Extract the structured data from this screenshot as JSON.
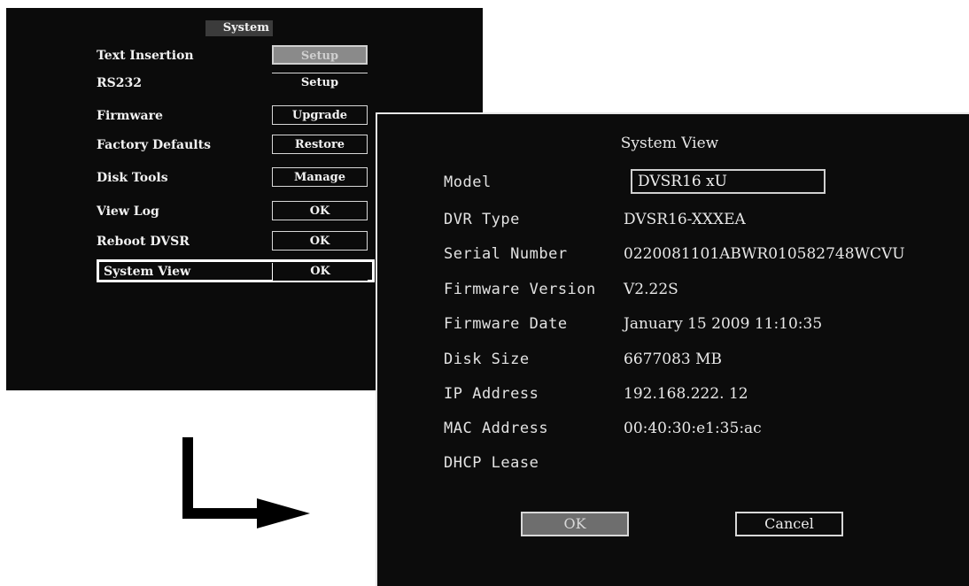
{
  "system_menu": {
    "title": "System",
    "items": [
      {
        "label": "Text Insertion",
        "button": "Setup"
      },
      {
        "label": "RS232",
        "button": "Setup"
      },
      {
        "label": "Firmware",
        "button": "Upgrade"
      },
      {
        "label": "Factory Defaults",
        "button": "Restore"
      },
      {
        "label": "Disk Tools",
        "button": "Manage"
      },
      {
        "label": "View Log",
        "button": "OK"
      },
      {
        "label": "Reboot DVSR",
        "button": "OK"
      },
      {
        "label": "System View",
        "button": "OK"
      }
    ],
    "selected_item": "System View",
    "focused_button": "Setup"
  },
  "system_view": {
    "title": "System View",
    "model_label": "Model",
    "model_value": "DVSR16 xU",
    "fields": [
      {
        "label": "DVR Type",
        "value": "DVSR16-XXXEA"
      },
      {
        "label": "Serial Number",
        "value": "0220081101ABWR010582748WCVU"
      },
      {
        "label": "Firmware Version",
        "value": "V2.22S"
      },
      {
        "label": "Firmware Date",
        "value": "January 15 2009 11:10:35"
      },
      {
        "label": "Disk Size",
        "value": "6677083 MB"
      },
      {
        "label": "IP Address",
        "value": "192.168.222. 12"
      },
      {
        "label": "MAC Address",
        "value": "00:40:30:e1:35:ac"
      },
      {
        "label": "DHCP Lease",
        "value": ""
      }
    ],
    "ok_label": "OK",
    "cancel_label": "Cancel"
  },
  "colors": {
    "screen_background": "#0b0b0b",
    "text": "#f2f2f2",
    "focused_button": "#8a8a8a",
    "ok_button": "#6e6e6e",
    "arrow": "#000000"
  },
  "icons": [
    "arrow-right-icon"
  ]
}
